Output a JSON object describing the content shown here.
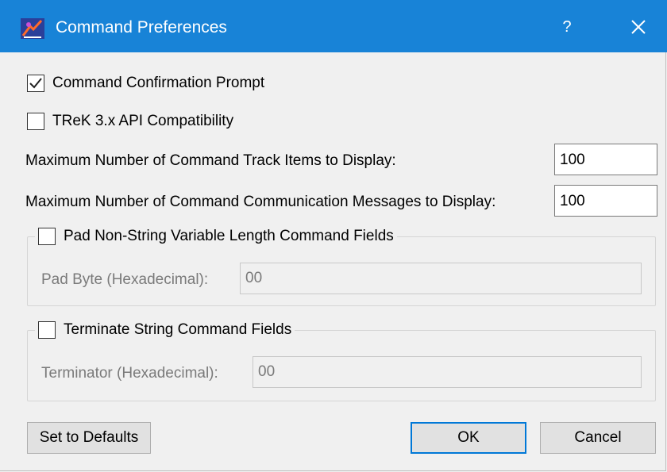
{
  "window": {
    "title": "Command Preferences",
    "help_glyph": "?",
    "icon": "app-icon"
  },
  "options": {
    "confirm_prompt": {
      "label": "Command Confirmation Prompt",
      "checked": true
    },
    "trek_api": {
      "label": "TReK 3.x API Compatibility",
      "checked": false
    }
  },
  "fields": {
    "track_items": {
      "label": "Maximum Number of Command Track Items to Display:",
      "value": "100"
    },
    "comm_messages": {
      "label": "Maximum Number of Command Communication Messages to Display:",
      "value": "100"
    }
  },
  "pad_group": {
    "label": "Pad Non-String Variable Length Command Fields",
    "checked": false,
    "field_label": "Pad Byte (Hexadecimal):",
    "field_value": "00"
  },
  "terminate_group": {
    "label": "Terminate String Command Fields",
    "checked": false,
    "field_label": "Terminator (Hexadecimal):",
    "field_value": "00"
  },
  "buttons": {
    "defaults": "Set to Defaults",
    "ok": "OK",
    "cancel": "Cancel"
  },
  "colors": {
    "titlebar": "#1883d7",
    "focus_border": "#0078d7",
    "disabled_text": "#7a7a7a"
  }
}
